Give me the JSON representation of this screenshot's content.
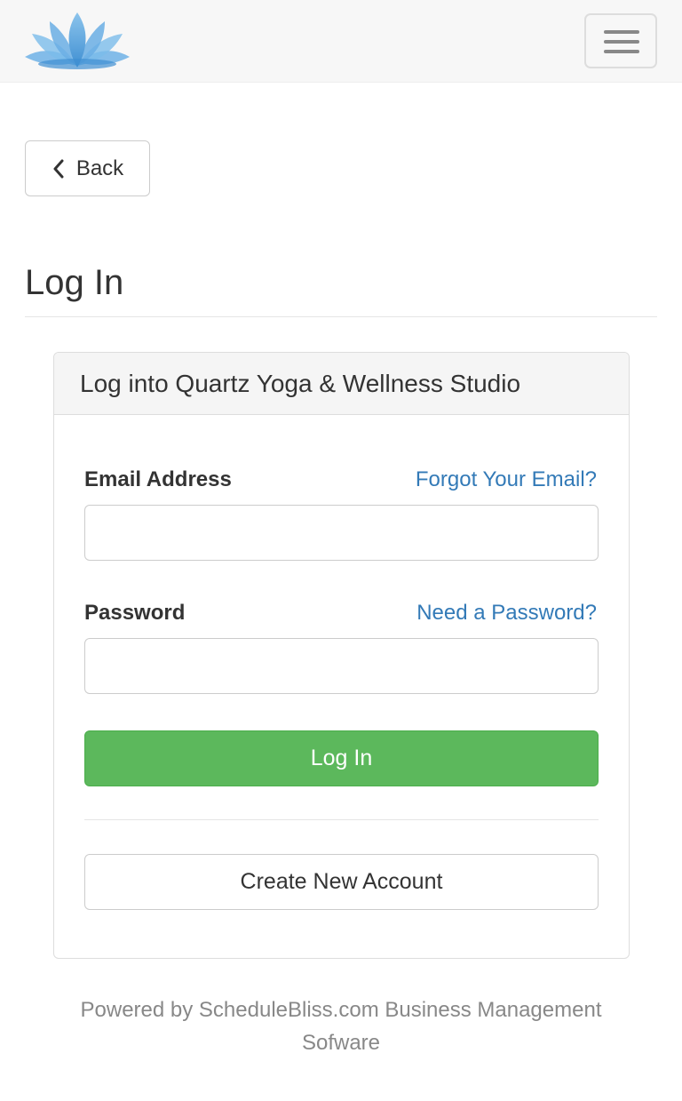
{
  "header": {
    "logo_icon": "lotus-logo-icon",
    "menu_icon": "hamburger-menu-icon",
    "brand_color": "#4a9ad6"
  },
  "back_button": {
    "icon": "chevron-left-icon",
    "label": "Back"
  },
  "page_title": "Log In",
  "panel": {
    "heading": "Log into Quartz Yoga & Wellness Studio",
    "email": {
      "label": "Email Address",
      "help_link": "Forgot Your Email?",
      "value": "",
      "placeholder": ""
    },
    "password": {
      "label": "Password",
      "help_link": "Need a Password?",
      "value": "",
      "placeholder": ""
    },
    "login_button": "Log In",
    "create_account_button": "Create New Account"
  },
  "footer": {
    "line1": "Powered by ScheduleBliss.com Business Management",
    "line2": "Sofware"
  },
  "colors": {
    "link": "#337ab7",
    "success": "#5cb85c",
    "panel_heading_bg": "#f5f5f5"
  }
}
